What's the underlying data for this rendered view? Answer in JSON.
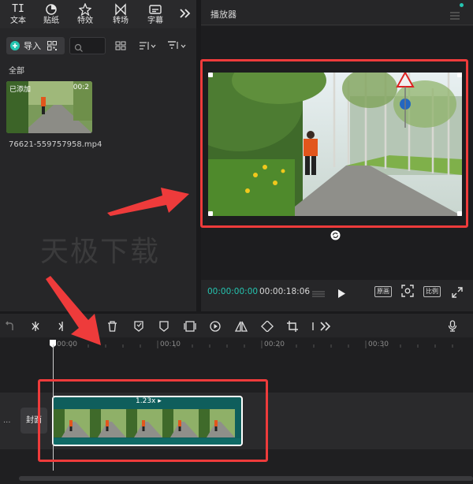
{
  "toolbar": {
    "items": [
      {
        "label": "文本",
        "icon": "text-icon"
      },
      {
        "label": "贴纸",
        "icon": "sticker-icon"
      },
      {
        "label": "特效",
        "icon": "effects-icon"
      },
      {
        "label": "转场",
        "icon": "transition-icon"
      },
      {
        "label": "字幕",
        "icon": "subtitle-icon"
      }
    ],
    "more_icon": "double-chevron-right-icon",
    "text_icon_glyph": "TI"
  },
  "media": {
    "import_label": "导入",
    "all_label": "全部",
    "item": {
      "added_badge": "已添加",
      "duration": "00:2",
      "filename": "76621-559757958.mp4"
    }
  },
  "watermark": "天极下载",
  "player": {
    "title": "播放器",
    "time_current": "00:00:00:00",
    "time_total": "00:00:18:06",
    "original_label": "原画",
    "ratio_label": "比例"
  },
  "timeline": {
    "ticks": [
      "00:00",
      "00:10",
      "00:20",
      "00:30"
    ],
    "cover_label": "封面",
    "clip_speed": "1.23x ▸",
    "more_dots": "···"
  },
  "colors": {
    "accent": "#25c4b0",
    "annotation": "#ee3b3b",
    "clip": "#0f5e5c"
  }
}
